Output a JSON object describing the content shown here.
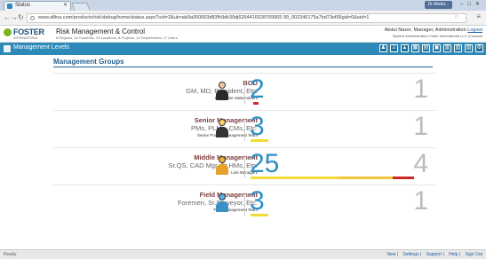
{
  "browser": {
    "tab_title": "Status",
    "user_chip": "Dr Abdul...",
    "url": "www.alfina.com/products/risk/debug/home/status.aspx?uid=2&uk=ab9a000663d83fh9dk39dj6264416928769065 99_002346175a7bd73ef06gid=0&eid=1"
  },
  "header": {
    "logo_name": "FOSTER",
    "logo_sub": "INTERNATIONAL",
    "title": "Risk Management & Control",
    "subtitle": "8 Regions, 16 Countries, 23 Locations, 8 Projects, 10 Departments, 17 Users",
    "user_line": "Abdul Nazer, Manager, Administration",
    "logout": "Logout",
    "org_line": "System Administration Foster International LLC (Compan"
  },
  "levels_bar": {
    "label": "Management Levels"
  },
  "section": {
    "title": "Management Groups"
  },
  "groups": [
    {
      "title": "BOD",
      "roles": "GM, MD, President, Etc.",
      "desc": "Enterprise Stakeholders",
      "count": "2",
      "total": "1",
      "avatar": "executive-avatar-icon"
    },
    {
      "title": "Senior Management",
      "roles": "PMs, PLMs, CMs, Etc.",
      "desc": "Senior Project Management Team",
      "count": "3",
      "total": "1",
      "avatar": "senior-manager-avatar-icon"
    },
    {
      "title": "Middle Management",
      "roles": "Sr.QS, CAD Mgr, Sr.HMs, Etc.",
      "desc": "Line Managers",
      "count": "25",
      "total": "4",
      "avatar": "middle-manager-avatar-icon"
    },
    {
      "title": "Field Management",
      "roles": "Foremen, Sr.Surveyor, Etc.",
      "desc": "Field Management Team",
      "count": "3",
      "total": "1",
      "avatar": "field-manager-avatar-icon"
    }
  ],
  "footer": {
    "status": "Ready",
    "links": [
      "New",
      "Settings",
      "Support",
      "Help",
      "Sign Out"
    ]
  },
  "colors": {
    "accent": "#2d89b8",
    "count_blue": "#2b8fc6",
    "bar_yellow": "#f2dc3a",
    "bar_red": "#cc2a2a"
  }
}
